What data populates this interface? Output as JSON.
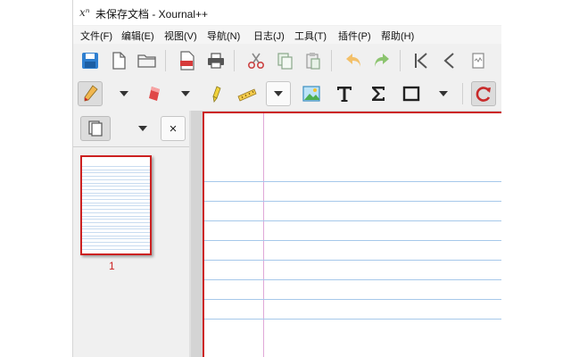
{
  "window": {
    "logo": "xⁿ",
    "title": "未保存文档 - Xournal++"
  },
  "menu": {
    "items": [
      "文件(F)",
      "编辑(E)",
      "视图(V)",
      "导航(N)",
      "日志(J)",
      "工具(T)",
      "插件(P)",
      "帮助(H)"
    ]
  },
  "icons": {
    "toolbar1": [
      "save-icon",
      "new-document-icon",
      "open-folder-icon",
      "export-pdf-icon",
      "print-icon",
      "cut-icon",
      "copy-icon",
      "paste-icon",
      "undo-icon",
      "redo-icon",
      "first-page-icon",
      "previous-page-icon",
      "page-preview-icon"
    ],
    "toolbar2": [
      "pen-icon",
      "pen-dropdown-icon",
      "eraser-icon",
      "eraser-dropdown-icon",
      "highlighter-icon",
      "ruler-icon",
      "tool-dropdown-icon",
      "image-icon",
      "text-tool-icon",
      "latex-sigma-icon",
      "rectangle-select-icon",
      "select-dropdown-icon",
      "refresh-icon"
    ]
  },
  "colors": {
    "accent_red": "#cc2121",
    "ruled_line": "#a6c8ea",
    "margin_line": "#e0a8d8"
  },
  "sidebar": {
    "close_label": "×",
    "pages": [
      {
        "number": "1"
      }
    ]
  }
}
